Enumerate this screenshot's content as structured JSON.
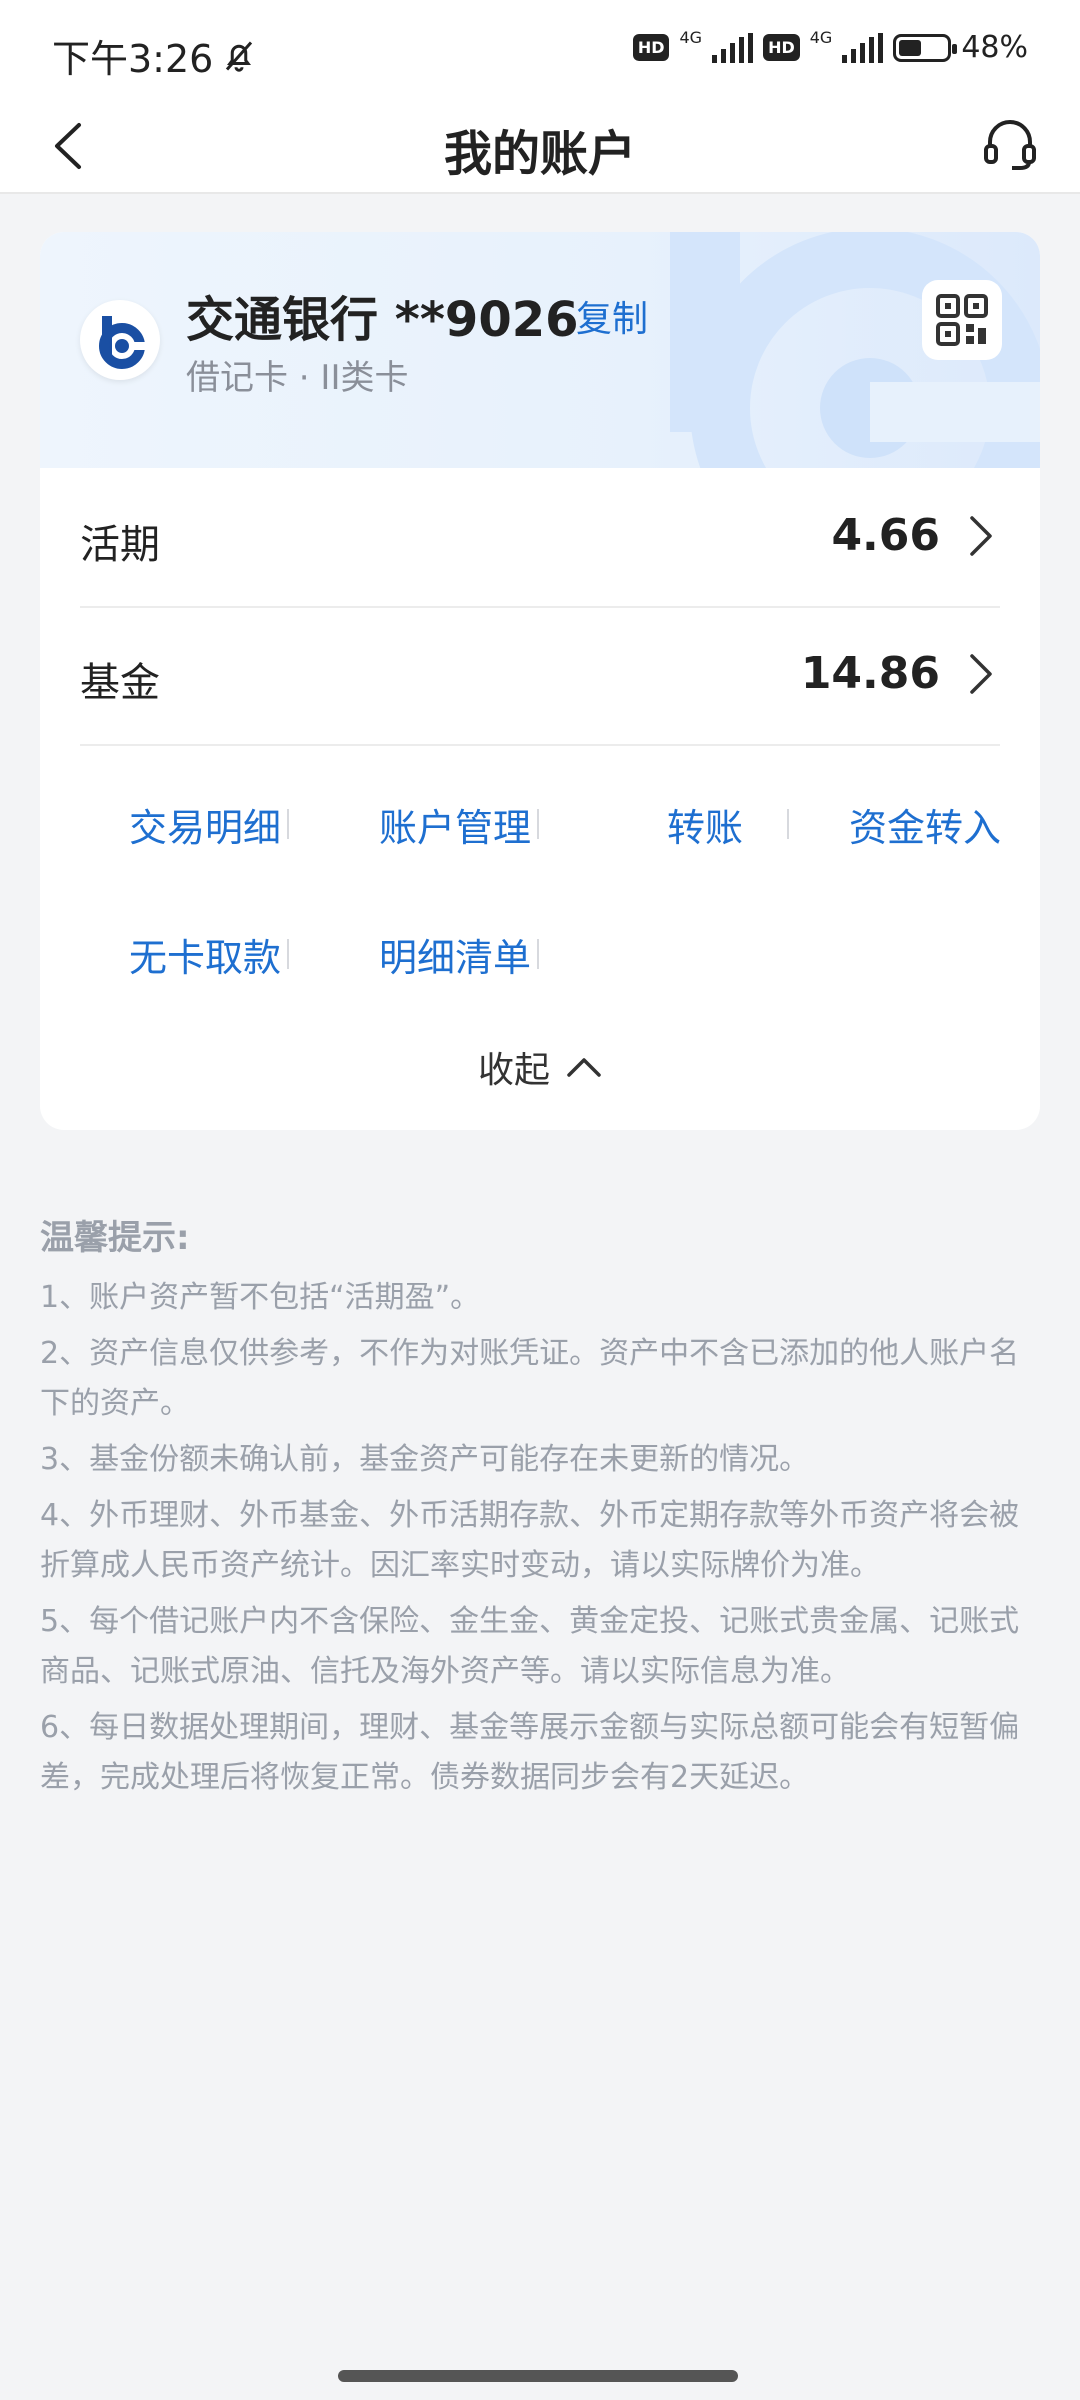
{
  "status": {
    "time": "下午3:26",
    "hd1": "HD",
    "net1": "4G",
    "hd2": "HD",
    "net2": "4G",
    "battery_level": 0.48,
    "battery_text": "48%"
  },
  "nav": {
    "title": "我的账户",
    "back_icon": "chevron-left-icon",
    "service_icon": "headset-icon"
  },
  "account": {
    "bank_name": "交通银行 **9026",
    "copy_label": "复制",
    "card_sub": "借记卡 · II类卡",
    "brand_color": "#1e6fd0"
  },
  "balances": [
    {
      "label": "活期",
      "value": "4.66"
    },
    {
      "label": "基金",
      "value": "14.86"
    }
  ],
  "actions": [
    "交易明细",
    "账户管理",
    "转账",
    "资金转入",
    "无卡取款",
    "明细清单"
  ],
  "collapse_label": "收起",
  "tips": {
    "title": "温馨提示:",
    "items": [
      "1、账户资产暂不包括“活期盈”。",
      "2、资产信息仅供参考，不作为对账凭证。资产中不含已添加的他人账户名下的资产。",
      "3、基金份额未确认前，基金资产可能存在未更新的情况。",
      "4、外币理财、外币基金、外币活期存款、外币定期存款等外币资产将会被折算成人民币资产统计。因汇率实时变动，请以实际牌价为准。",
      "5、每个借记账户内不含保险、金生金、黄金定投、记账式贵金属、记账式商品、记账式原油、信托及海外资产等。请以实际信息为准。",
      "6、每日数据处理期间，理财、基金等展示金额与实际总额可能会有短暂偏差，完成处理后将恢复正常。债券数据同步会有2天延迟。"
    ]
  }
}
